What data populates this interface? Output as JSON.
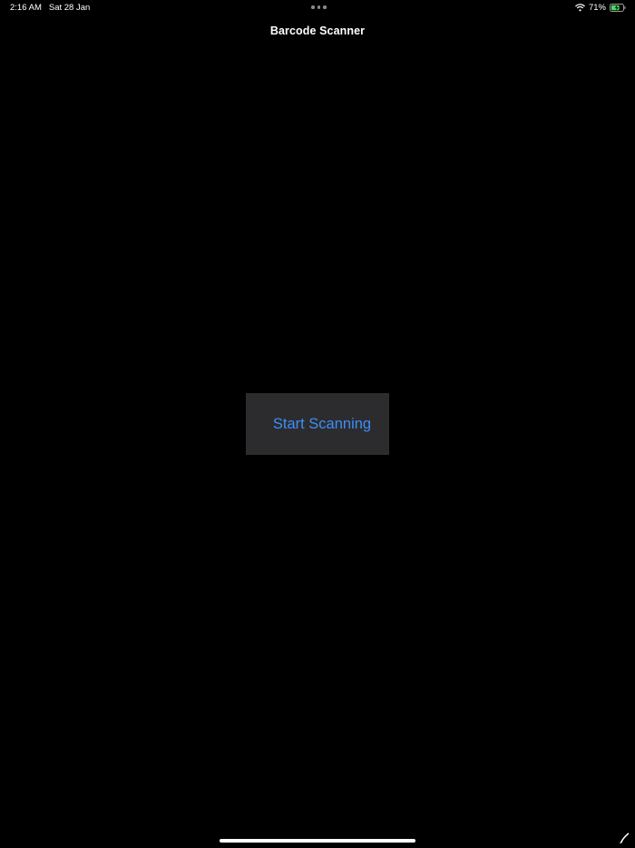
{
  "status_bar": {
    "time": "2:16 AM",
    "date": "Sat 28 Jan",
    "battery_percent": "71%",
    "battery_level": 0.71,
    "icons": [
      "wifi-icon",
      "battery-charging-icon"
    ]
  },
  "nav": {
    "title": "Barcode Scanner"
  },
  "main": {
    "start_button_label": "Start Scanning"
  },
  "colors": {
    "background": "#000000",
    "button_background": "#2c2c2e",
    "accent": "#3d8ef7",
    "text": "#ffffff",
    "battery_charge": "#4cd964"
  }
}
